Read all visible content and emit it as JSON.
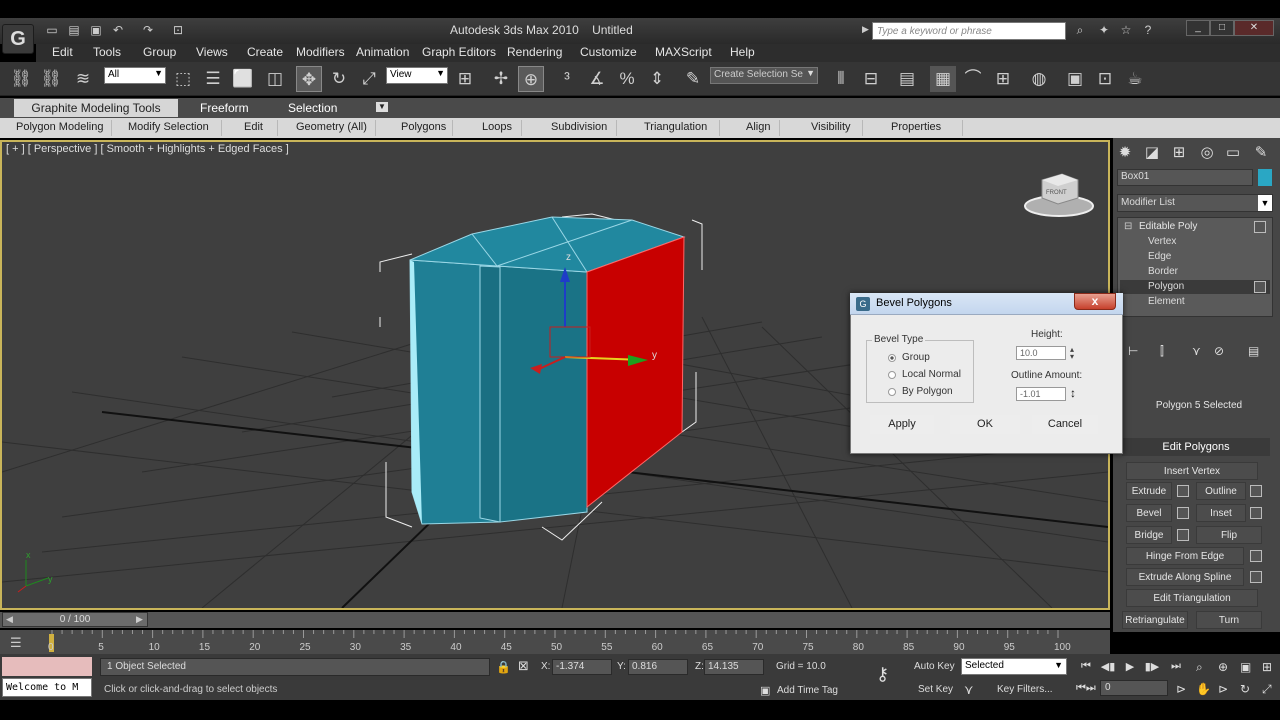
{
  "title_bar": {
    "app_title": "Autodesk 3ds Max 2010",
    "doc_title": "Untitled",
    "search_placeholder": "Type a keyword or phrase"
  },
  "menu": [
    "Edit",
    "Tools",
    "Group",
    "Views",
    "Create",
    "Modifiers",
    "Animation",
    "Graph Editors",
    "Rendering",
    "Customize",
    "MAXScript",
    "Help"
  ],
  "toolbar": {
    "selection_filter": "All",
    "reference_coord": "View",
    "named_selection_placeholder": "Create Selection Se"
  },
  "ribbon": {
    "tabs": [
      "Graphite Modeling Tools",
      "Freeform",
      "Selection"
    ],
    "panels": [
      "Polygon Modeling",
      "Modify Selection",
      "Edit",
      "Geometry (All)",
      "Polygons",
      "Loops",
      "Subdivision",
      "Triangulation",
      "Align",
      "Visibility",
      "Properties"
    ]
  },
  "viewport": {
    "label": "[ + ] [ Perspective ] [ Smooth + Highlights + Edged Faces ]",
    "viewcube_label": "FRONT",
    "gizmo_y_label": "y",
    "gizmo_z_label": "z",
    "mesh_color": "#1f7f95",
    "selected_face_color": "#c80000",
    "axis_y": "y",
    "axis_x": "x"
  },
  "command_panel": {
    "object_name": "Box01",
    "object_color": "#2aa7c4",
    "modifier_list": "Modifier List",
    "stack": {
      "root": "Editable Poly",
      "subs": [
        "Vertex",
        "Edge",
        "Border",
        "Polygon",
        "Element"
      ],
      "selected": "Polygon"
    },
    "selection_status": "Polygon 5 Selected",
    "rollout_title": "Edit Polygons",
    "buttons": {
      "insert_vertex": "Insert Vertex",
      "extrude": "Extrude",
      "outline": "Outline",
      "bevel": "Bevel",
      "inset": "Inset",
      "bridge": "Bridge",
      "flip": "Flip",
      "hinge_from_edge": "Hinge From Edge",
      "extrude_along_spline": "Extrude Along Spline",
      "edit_triangulation": "Edit Triangulation",
      "retriangulate": "Retriangulate",
      "turn": "Turn"
    }
  },
  "dialog": {
    "title": "Bevel Polygons",
    "close": "x",
    "group_label": "Bevel Type",
    "options": [
      "Group",
      "Local Normal",
      "By Polygon"
    ],
    "selected_option": "Group",
    "height_label": "Height:",
    "height_value": "10.0",
    "outline_label": "Outline Amount:",
    "outline_value": "-1.01",
    "apply": "Apply",
    "ok": "OK",
    "cancel": "Cancel"
  },
  "timeline": {
    "slider_label": "0 / 100",
    "ticks": [
      "0",
      "5",
      "10",
      "15",
      "20",
      "25",
      "30",
      "35",
      "40",
      "45",
      "50",
      "55",
      "60",
      "65",
      "70",
      "75",
      "80",
      "85",
      "90",
      "95",
      "100"
    ]
  },
  "status_bar": {
    "maxscript_text": "Welcome to M",
    "selection_count": "1 Object Selected",
    "prompt": "Click or click-and-drag to select objects",
    "x_label": "X:",
    "x_value": "-1.374",
    "y_label": "Y:",
    "y_value": "0.816",
    "z_label": "Z:",
    "z_value": "14.135",
    "grid": "Grid = 10.0",
    "auto_key": "Auto Key",
    "set_key": "Set Key",
    "key_mode": "Selected",
    "key_filters": "Key Filters...",
    "add_time_tag": "Add Time Tag",
    "frame_value": "0"
  }
}
